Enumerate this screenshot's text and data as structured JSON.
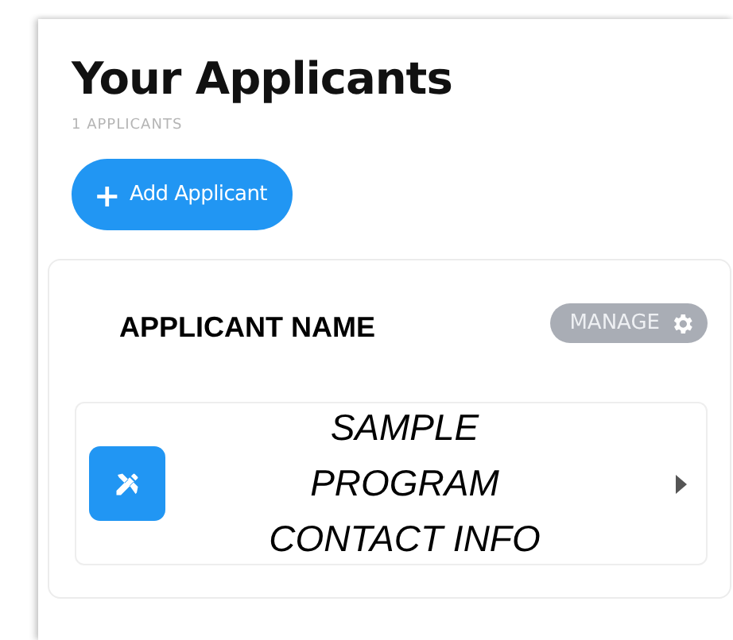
{
  "header": {
    "title": "Your Applicants",
    "count": "1 APPLICANTS"
  },
  "add_button": {
    "icon": "+",
    "label": "Add Applicant"
  },
  "applicants": [
    {
      "name": "APPLICANT NAME",
      "manage_label": "MANAGE",
      "program": {
        "text": "SAMPLE PROGRAM CONTACT INFO"
      }
    }
  ]
}
